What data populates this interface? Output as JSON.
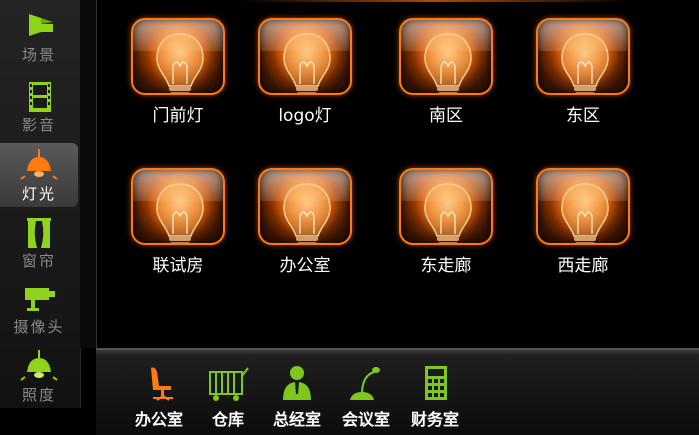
{
  "sidebar": {
    "items": [
      {
        "label": "场景",
        "icon": "scene-icon"
      },
      {
        "label": "影音",
        "icon": "film-icon"
      },
      {
        "label": "灯光",
        "icon": "lamp-icon",
        "active": true
      },
      {
        "label": "窗帘",
        "icon": "curtain-icon"
      },
      {
        "label": "摄像头",
        "icon": "camera-icon"
      },
      {
        "label": "照度",
        "icon": "illuminance-icon"
      }
    ]
  },
  "lights": [
    {
      "label": "门前灯"
    },
    {
      "label": "logo灯"
    },
    {
      "label": "南区"
    },
    {
      "label": "东区"
    },
    {
      "label": "联试房"
    },
    {
      "label": "办公室"
    },
    {
      "label": "东走廊"
    },
    {
      "label": "西走廊"
    }
  ],
  "rooms": [
    {
      "label": "办公室",
      "icon": "office-chair-icon"
    },
    {
      "label": "仓库",
      "icon": "warehouse-cart-icon"
    },
    {
      "label": "总经室",
      "icon": "manager-icon"
    },
    {
      "label": "会议室",
      "icon": "microphone-icon"
    },
    {
      "label": "财务室",
      "icon": "calculator-icon"
    }
  ],
  "colors": {
    "accent": "#ff7a10",
    "icon_green": "#7ec81e",
    "sidebar_icon": "#8fd41a"
  }
}
